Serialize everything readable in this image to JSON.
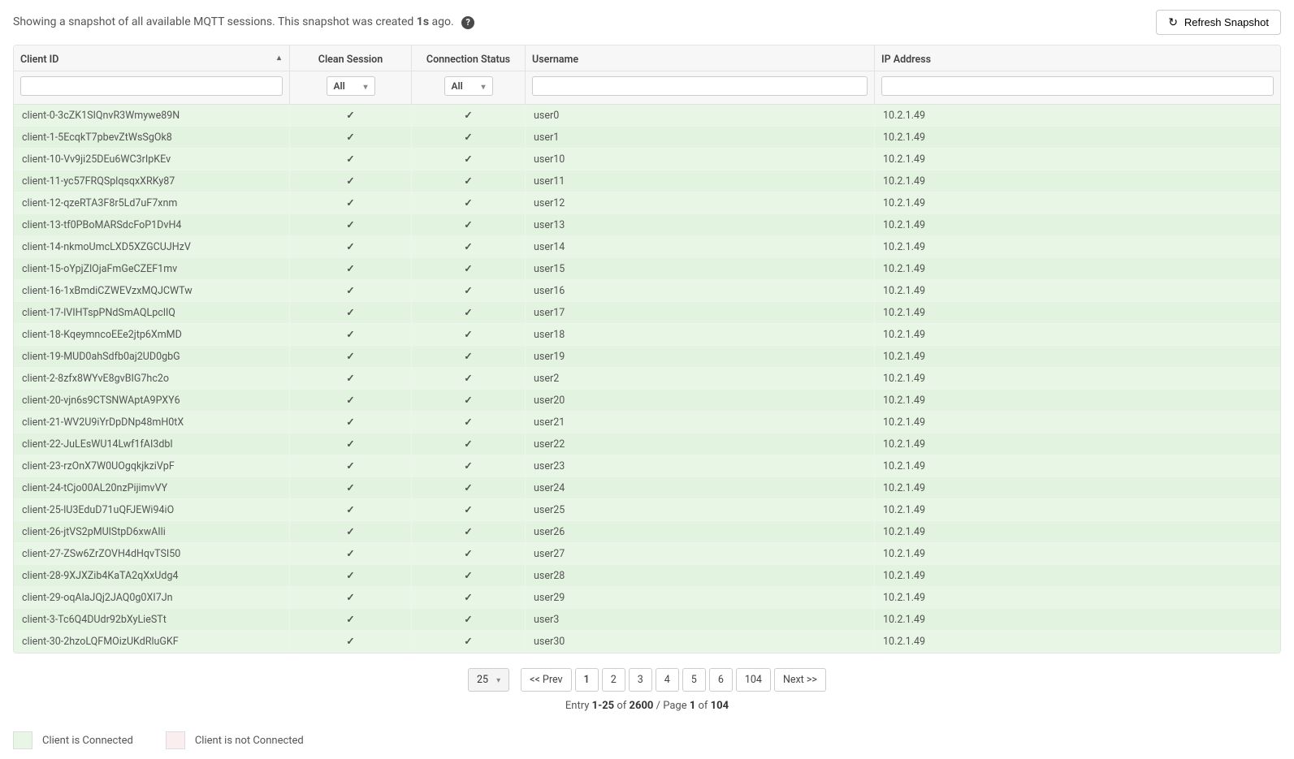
{
  "header": {
    "snapshot_prefix": "Showing a snapshot of all available MQTT sessions. This snapshot was created ",
    "snapshot_age": "1s",
    "snapshot_suffix": " ago.",
    "refresh_label": "Refresh Snapshot"
  },
  "columns": {
    "client_id": "Client ID",
    "clean_session": "Clean Session",
    "connection_status": "Connection Status",
    "username": "Username",
    "ip": "IP Address"
  },
  "filters": {
    "all_label": "All"
  },
  "rows": [
    {
      "client": "client-0-3cZK1SIQnvR3Wmywe89N",
      "clean": true,
      "connected": true,
      "user": "user0",
      "ip": "10.2.1.49"
    },
    {
      "client": "client-1-5EcqkT7pbevZtWsSgOk8",
      "clean": true,
      "connected": true,
      "user": "user1",
      "ip": "10.2.1.49"
    },
    {
      "client": "client-10-Vv9ji25DEu6WC3rIpKEv",
      "clean": true,
      "connected": true,
      "user": "user10",
      "ip": "10.2.1.49"
    },
    {
      "client": "client-11-yc57FRQSplqsqxXRKy87",
      "clean": true,
      "connected": true,
      "user": "user11",
      "ip": "10.2.1.49"
    },
    {
      "client": "client-12-qzeRTA3F8r5Ld7uF7xnm",
      "clean": true,
      "connected": true,
      "user": "user12",
      "ip": "10.2.1.49"
    },
    {
      "client": "client-13-tf0PBoMARSdcFoP1DvH4",
      "clean": true,
      "connected": true,
      "user": "user13",
      "ip": "10.2.1.49"
    },
    {
      "client": "client-14-nkmoUmcLXD5XZGCUJHzV",
      "clean": true,
      "connected": true,
      "user": "user14",
      "ip": "10.2.1.49"
    },
    {
      "client": "client-15-oYpjZlOjaFmGeCZEF1mv",
      "clean": true,
      "connected": true,
      "user": "user15",
      "ip": "10.2.1.49"
    },
    {
      "client": "client-16-1xBmdiCZWEVzxMQJCWTw",
      "clean": true,
      "connected": true,
      "user": "user16",
      "ip": "10.2.1.49"
    },
    {
      "client": "client-17-lVIHTspPNdSmAQLpcIlQ",
      "clean": true,
      "connected": true,
      "user": "user17",
      "ip": "10.2.1.49"
    },
    {
      "client": "client-18-KqeymncoEEe2jtp6XmMD",
      "clean": true,
      "connected": true,
      "user": "user18",
      "ip": "10.2.1.49"
    },
    {
      "client": "client-19-MUD0ahSdfb0aj2UD0gbG",
      "clean": true,
      "connected": true,
      "user": "user19",
      "ip": "10.2.1.49"
    },
    {
      "client": "client-2-8zfx8WYvE8gvBIG7hc2o",
      "clean": true,
      "connected": true,
      "user": "user2",
      "ip": "10.2.1.49"
    },
    {
      "client": "client-20-vjn6s9CTSNWAptA9PXY6",
      "clean": true,
      "connected": true,
      "user": "user20",
      "ip": "10.2.1.49"
    },
    {
      "client": "client-21-WV2U9iYrDpDNp48mH0tX",
      "clean": true,
      "connected": true,
      "user": "user21",
      "ip": "10.2.1.49"
    },
    {
      "client": "client-22-JuLEsWU14Lwf1fAI3dbl",
      "clean": true,
      "connected": true,
      "user": "user22",
      "ip": "10.2.1.49"
    },
    {
      "client": "client-23-rzOnX7W0UOgqkjkziVpF",
      "clean": true,
      "connected": true,
      "user": "user23",
      "ip": "10.2.1.49"
    },
    {
      "client": "client-24-tCjo00AL20nzPijimvVY",
      "clean": true,
      "connected": true,
      "user": "user24",
      "ip": "10.2.1.49"
    },
    {
      "client": "client-25-lU3EduD71uQFJEWi94iO",
      "clean": true,
      "connected": true,
      "user": "user25",
      "ip": "10.2.1.49"
    },
    {
      "client": "client-26-jtVS2pMUlStpD6xwAIli",
      "clean": true,
      "connected": true,
      "user": "user26",
      "ip": "10.2.1.49"
    },
    {
      "client": "client-27-ZSw6ZrZOVH4dHqvTSI50",
      "clean": true,
      "connected": true,
      "user": "user27",
      "ip": "10.2.1.49"
    },
    {
      "client": "client-28-9XJXZib4KaTA2qXxUdg4",
      "clean": true,
      "connected": true,
      "user": "user28",
      "ip": "10.2.1.49"
    },
    {
      "client": "client-29-oqAlaJQj2JAQ0g0XI7Jn",
      "clean": true,
      "connected": true,
      "user": "user29",
      "ip": "10.2.1.49"
    },
    {
      "client": "client-3-Tc6Q4DUdr92bXyLieSTt",
      "clean": true,
      "connected": true,
      "user": "user3",
      "ip": "10.2.1.49"
    },
    {
      "client": "client-30-2hzoLQFMOizUKdRluGKF",
      "clean": true,
      "connected": true,
      "user": "user30",
      "ip": "10.2.1.49"
    }
  ],
  "pagination": {
    "page_size": "25",
    "prev": "<< Prev",
    "next": "Next >>",
    "pages": [
      "1",
      "2",
      "3",
      "4",
      "5",
      "6",
      "104"
    ],
    "active": "1",
    "summary_prefix": "Entry ",
    "entry_range": "1-25",
    "of": " of ",
    "total": "2600",
    "page_sep": " / Page ",
    "current_page": "1",
    "total_pages": "104"
  },
  "legend": {
    "connected": "Client is Connected",
    "disconnected": "Client is not Connected"
  }
}
